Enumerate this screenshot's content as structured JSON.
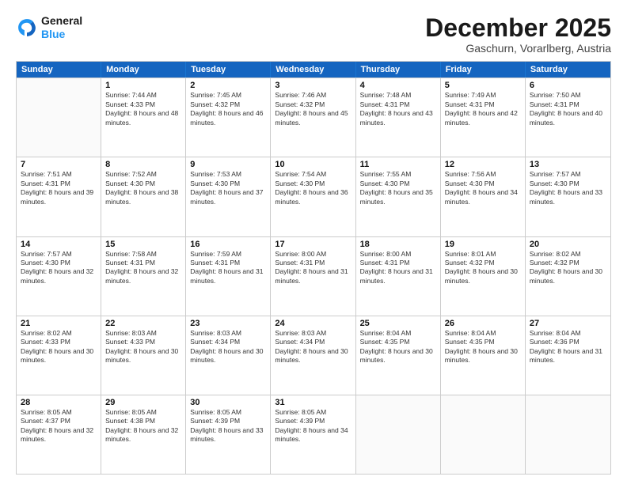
{
  "logo": {
    "line1": "General",
    "line2": "Blue"
  },
  "title": "December 2025",
  "subtitle": "Gaschurn, Vorarlberg, Austria",
  "header_days": [
    "Sunday",
    "Monday",
    "Tuesday",
    "Wednesday",
    "Thursday",
    "Friday",
    "Saturday"
  ],
  "weeks": [
    [
      {
        "day": "",
        "sunrise": "",
        "sunset": "",
        "daylight": ""
      },
      {
        "day": "1",
        "sunrise": "Sunrise: 7:44 AM",
        "sunset": "Sunset: 4:33 PM",
        "daylight": "Daylight: 8 hours and 48 minutes."
      },
      {
        "day": "2",
        "sunrise": "Sunrise: 7:45 AM",
        "sunset": "Sunset: 4:32 PM",
        "daylight": "Daylight: 8 hours and 46 minutes."
      },
      {
        "day": "3",
        "sunrise": "Sunrise: 7:46 AM",
        "sunset": "Sunset: 4:32 PM",
        "daylight": "Daylight: 8 hours and 45 minutes."
      },
      {
        "day": "4",
        "sunrise": "Sunrise: 7:48 AM",
        "sunset": "Sunset: 4:31 PM",
        "daylight": "Daylight: 8 hours and 43 minutes."
      },
      {
        "day": "5",
        "sunrise": "Sunrise: 7:49 AM",
        "sunset": "Sunset: 4:31 PM",
        "daylight": "Daylight: 8 hours and 42 minutes."
      },
      {
        "day": "6",
        "sunrise": "Sunrise: 7:50 AM",
        "sunset": "Sunset: 4:31 PM",
        "daylight": "Daylight: 8 hours and 40 minutes."
      }
    ],
    [
      {
        "day": "7",
        "sunrise": "Sunrise: 7:51 AM",
        "sunset": "Sunset: 4:31 PM",
        "daylight": "Daylight: 8 hours and 39 minutes."
      },
      {
        "day": "8",
        "sunrise": "Sunrise: 7:52 AM",
        "sunset": "Sunset: 4:30 PM",
        "daylight": "Daylight: 8 hours and 38 minutes."
      },
      {
        "day": "9",
        "sunrise": "Sunrise: 7:53 AM",
        "sunset": "Sunset: 4:30 PM",
        "daylight": "Daylight: 8 hours and 37 minutes."
      },
      {
        "day": "10",
        "sunrise": "Sunrise: 7:54 AM",
        "sunset": "Sunset: 4:30 PM",
        "daylight": "Daylight: 8 hours and 36 minutes."
      },
      {
        "day": "11",
        "sunrise": "Sunrise: 7:55 AM",
        "sunset": "Sunset: 4:30 PM",
        "daylight": "Daylight: 8 hours and 35 minutes."
      },
      {
        "day": "12",
        "sunrise": "Sunrise: 7:56 AM",
        "sunset": "Sunset: 4:30 PM",
        "daylight": "Daylight: 8 hours and 34 minutes."
      },
      {
        "day": "13",
        "sunrise": "Sunrise: 7:57 AM",
        "sunset": "Sunset: 4:30 PM",
        "daylight": "Daylight: 8 hours and 33 minutes."
      }
    ],
    [
      {
        "day": "14",
        "sunrise": "Sunrise: 7:57 AM",
        "sunset": "Sunset: 4:30 PM",
        "daylight": "Daylight: 8 hours and 32 minutes."
      },
      {
        "day": "15",
        "sunrise": "Sunrise: 7:58 AM",
        "sunset": "Sunset: 4:31 PM",
        "daylight": "Daylight: 8 hours and 32 minutes."
      },
      {
        "day": "16",
        "sunrise": "Sunrise: 7:59 AM",
        "sunset": "Sunset: 4:31 PM",
        "daylight": "Daylight: 8 hours and 31 minutes."
      },
      {
        "day": "17",
        "sunrise": "Sunrise: 8:00 AM",
        "sunset": "Sunset: 4:31 PM",
        "daylight": "Daylight: 8 hours and 31 minutes."
      },
      {
        "day": "18",
        "sunrise": "Sunrise: 8:00 AM",
        "sunset": "Sunset: 4:31 PM",
        "daylight": "Daylight: 8 hours and 31 minutes."
      },
      {
        "day": "19",
        "sunrise": "Sunrise: 8:01 AM",
        "sunset": "Sunset: 4:32 PM",
        "daylight": "Daylight: 8 hours and 30 minutes."
      },
      {
        "day": "20",
        "sunrise": "Sunrise: 8:02 AM",
        "sunset": "Sunset: 4:32 PM",
        "daylight": "Daylight: 8 hours and 30 minutes."
      }
    ],
    [
      {
        "day": "21",
        "sunrise": "Sunrise: 8:02 AM",
        "sunset": "Sunset: 4:33 PM",
        "daylight": "Daylight: 8 hours and 30 minutes."
      },
      {
        "day": "22",
        "sunrise": "Sunrise: 8:03 AM",
        "sunset": "Sunset: 4:33 PM",
        "daylight": "Daylight: 8 hours and 30 minutes."
      },
      {
        "day": "23",
        "sunrise": "Sunrise: 8:03 AM",
        "sunset": "Sunset: 4:34 PM",
        "daylight": "Daylight: 8 hours and 30 minutes."
      },
      {
        "day": "24",
        "sunrise": "Sunrise: 8:03 AM",
        "sunset": "Sunset: 4:34 PM",
        "daylight": "Daylight: 8 hours and 30 minutes."
      },
      {
        "day": "25",
        "sunrise": "Sunrise: 8:04 AM",
        "sunset": "Sunset: 4:35 PM",
        "daylight": "Daylight: 8 hours and 30 minutes."
      },
      {
        "day": "26",
        "sunrise": "Sunrise: 8:04 AM",
        "sunset": "Sunset: 4:35 PM",
        "daylight": "Daylight: 8 hours and 30 minutes."
      },
      {
        "day": "27",
        "sunrise": "Sunrise: 8:04 AM",
        "sunset": "Sunset: 4:36 PM",
        "daylight": "Daylight: 8 hours and 31 minutes."
      }
    ],
    [
      {
        "day": "28",
        "sunrise": "Sunrise: 8:05 AM",
        "sunset": "Sunset: 4:37 PM",
        "daylight": "Daylight: 8 hours and 32 minutes."
      },
      {
        "day": "29",
        "sunrise": "Sunrise: 8:05 AM",
        "sunset": "Sunset: 4:38 PM",
        "daylight": "Daylight: 8 hours and 32 minutes."
      },
      {
        "day": "30",
        "sunrise": "Sunrise: 8:05 AM",
        "sunset": "Sunset: 4:39 PM",
        "daylight": "Daylight: 8 hours and 33 minutes."
      },
      {
        "day": "31",
        "sunrise": "Sunrise: 8:05 AM",
        "sunset": "Sunset: 4:39 PM",
        "daylight": "Daylight: 8 hours and 34 minutes."
      },
      {
        "day": "",
        "sunrise": "",
        "sunset": "",
        "daylight": ""
      },
      {
        "day": "",
        "sunrise": "",
        "sunset": "",
        "daylight": ""
      },
      {
        "day": "",
        "sunrise": "",
        "sunset": "",
        "daylight": ""
      }
    ]
  ]
}
